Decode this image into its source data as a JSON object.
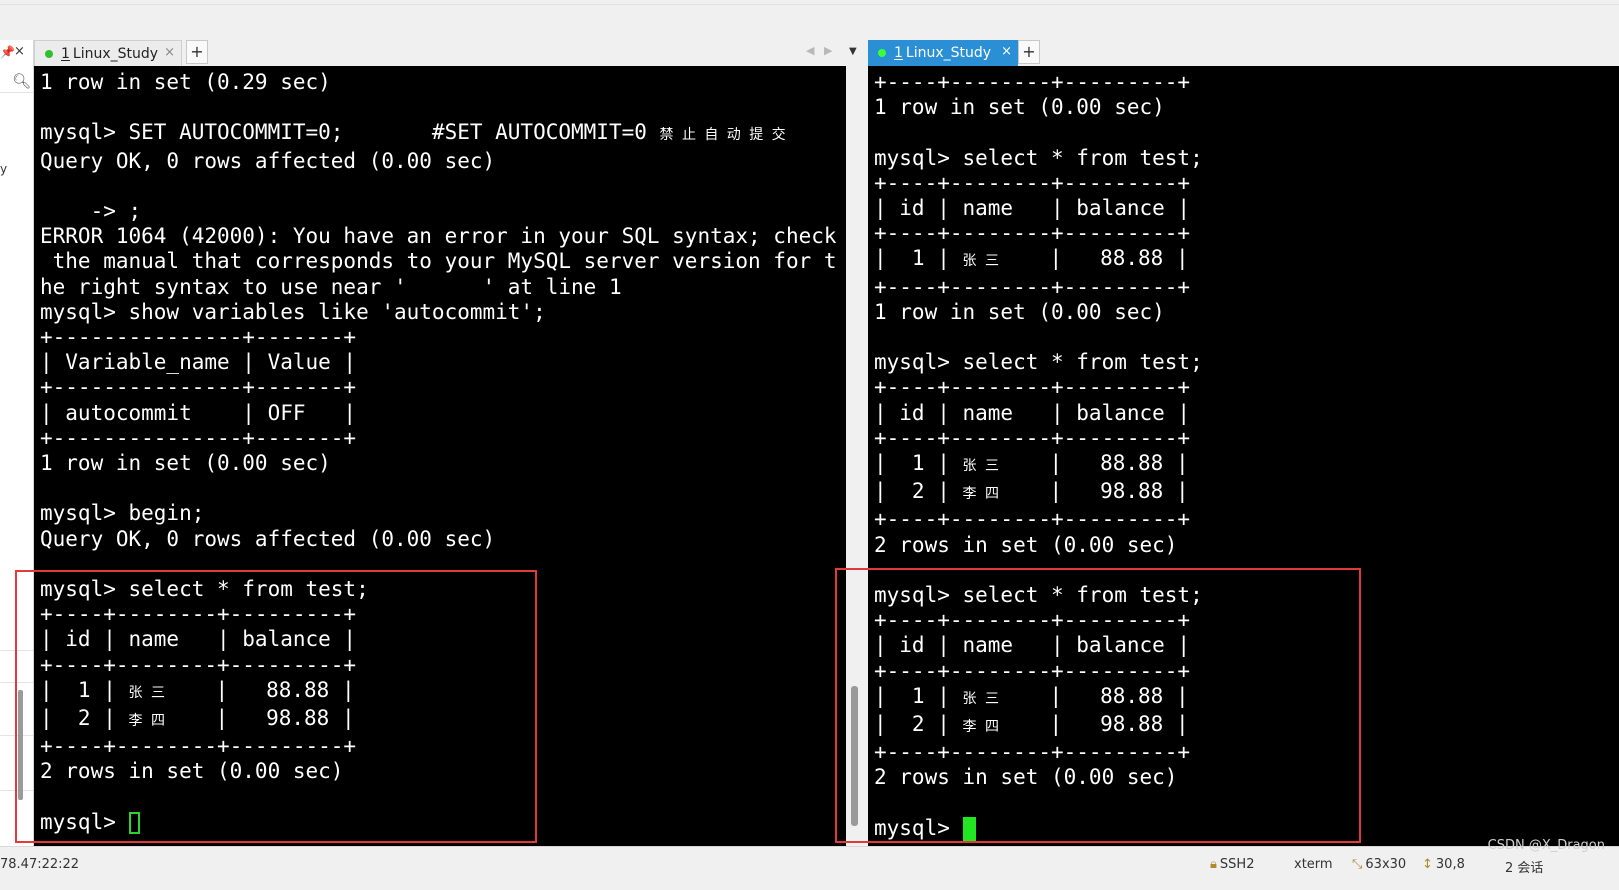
{
  "left_pane": {
    "pin_icon": "pin-icon",
    "close_icon": "×",
    "search_icon": "search-icon",
    "tab": {
      "number": "1",
      "title": "Linux_Study",
      "close": "×"
    },
    "add_tab": "+",
    "nav_prev": "◀",
    "nav_next": "▶",
    "tab_menu": "▼",
    "lines": [
      "1 row in set (0.29 sec)",
      "",
      "mysql> SET AUTOCOMMIT=0;       #SET AUTOCOMMIT=0 ",
      "Query OK, 0 rows affected (0.00 sec)",
      "",
      "    -> ;",
      "ERROR 1064 (42000): You have an error in your SQL syntax; check",
      " the manual that corresponds to your MySQL server version for t",
      "he right syntax to use near '      ' at line 1",
      "mysql> show variables like 'autocommit';",
      "+---------------+-------+",
      "| Variable_name | Value |",
      "+---------------+-------+",
      "| autocommit    | OFF   |",
      "+---------------+-------+",
      "1 row in set (0.00 sec)",
      "",
      "mysql> begin;",
      "Query OK, 0 rows affected (0.00 sec)",
      "",
      "mysql> select * from test;",
      "+----+--------+---------+",
      "| id | name   | balance |",
      "+----+--------+---------+",
      "|  1 | 张三   |   88.88 |",
      "|  2 | 李四   |   98.88 |",
      "+----+--------+---------+",
      "2 rows in set (0.00 sec)",
      "",
      "mysql> "
    ],
    "comment_cjk": "禁止自动提交"
  },
  "right_pane": {
    "tab": {
      "number": "1",
      "title": "Linux_Study",
      "close": "×"
    },
    "add_tab": "+",
    "lines": [
      "+----+--------+---------+",
      "1 row in set (0.00 sec)",
      "",
      "mysql> select * from test;",
      "+----+--------+---------+",
      "| id | name   | balance |",
      "+----+--------+---------+",
      "|  1 | 张三   |   88.88 |",
      "+----+--------+---------+",
      "1 row in set (0.00 sec)",
      "",
      "mysql> select * from test;",
      "+----+--------+---------+",
      "| id | name   | balance |",
      "+----+--------+---------+",
      "|  1 | 张三   |   88.88 |",
      "|  2 | 李四   |   98.88 |",
      "+----+--------+---------+",
      "2 rows in set (0.00 sec)",
      "",
      "mysql> select * from test;",
      "+----+--------+---------+",
      "| id | name   | balance |",
      "+----+--------+---------+",
      "|  1 | 张三   |   88.88 |",
      "|  2 | 李四   |   98.88 |",
      "+----+--------+---------+",
      "2 rows in set (0.00 sec)",
      "",
      "mysql> "
    ]
  },
  "status_bar": {
    "host": "78.47:22:22",
    "protocol": "SSH2",
    "terminal": "xterm",
    "size": "63x30",
    "position": "30,8",
    "sessions": "2 会话"
  },
  "watermark": "CSDN @X_Dragon",
  "colors": {
    "terminal_bg": "#000000",
    "terminal_fg": "#ffffff",
    "active_tab": "#2b8fd6",
    "cursor": "#22e622",
    "highlight": "#e23a3a"
  }
}
